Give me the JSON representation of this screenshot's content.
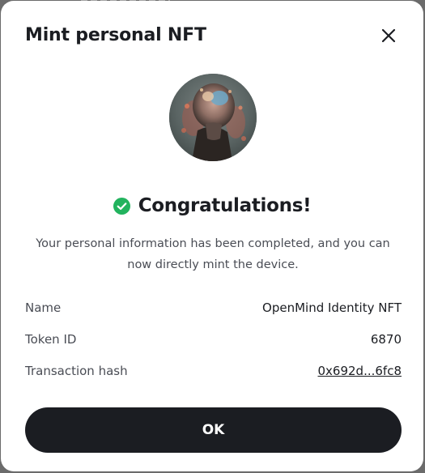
{
  "dialog": {
    "title": "Mint personal NFT",
    "close_icon": "close-icon",
    "avatar_image": "nft-avatar"
  },
  "success": {
    "icon": "check-circle-icon",
    "icon_color": "#22b35e",
    "heading": "Congratulations!",
    "message": "Your personal information has been completed, and you can now directly mint the device."
  },
  "details": [
    {
      "label": "Name",
      "value": "OpenMind Identity NFT"
    },
    {
      "label": "Token ID",
      "value": "6870"
    },
    {
      "label": "Transaction hash",
      "value": "0x692d...6fc8"
    }
  ],
  "actions": {
    "ok_label": "OK",
    "ok_color": "#1b1d22"
  }
}
